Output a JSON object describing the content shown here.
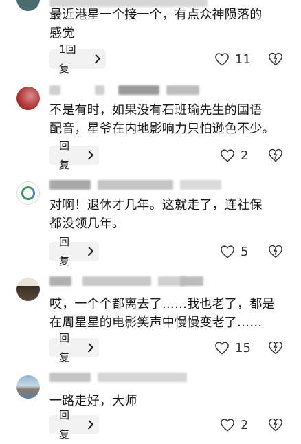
{
  "comments": [
    {
      "text": "最近港星一个接一个，有点众神陨落的\n感觉",
      "reply_label": "1回复",
      "likes": "11",
      "avatar_color": "#4a6c6f"
    },
    {
      "text": "不是有时，如果没有石班瑜先生的国语\n配音，星爷在内地影响力只怕逊色不少。",
      "reply_label": "回复",
      "likes": "2",
      "avatar_color": "#b23a3a"
    },
    {
      "text": "对啊！退休才几年。这就走了，连社保\n都没领几年。",
      "reply_label": "回复",
      "likes": "5",
      "avatar_color": "#2e8b57"
    },
    {
      "text": "哎，一个个都离去了……我也老了，都是\n在周星星的电影笑声中慢慢变老了……",
      "reply_label": "回复",
      "likes": "15",
      "avatar_color": "#5a4a3a"
    },
    {
      "text": "一路走好，大师",
      "reply_label": "回复",
      "likes": "2",
      "avatar_color": "#5b7fa8"
    }
  ]
}
